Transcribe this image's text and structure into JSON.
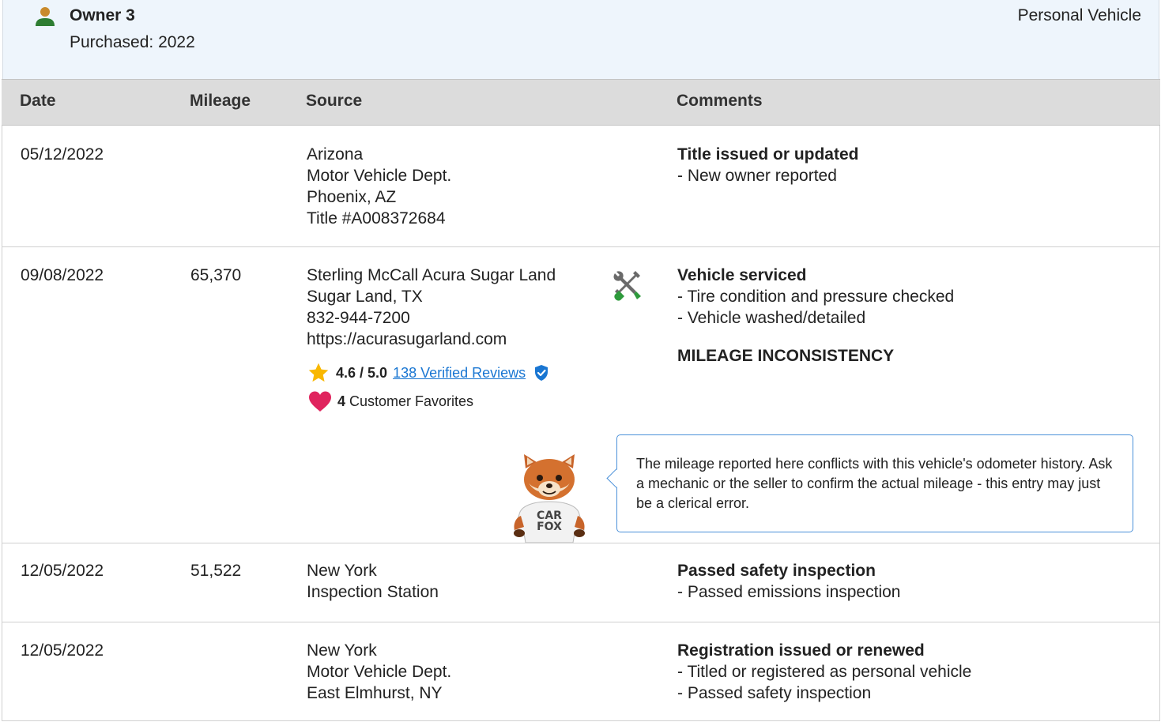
{
  "owner": {
    "name": "Owner 3",
    "purchased": "Purchased: 2022",
    "vehicle_type": "Personal Vehicle"
  },
  "table": {
    "headers": {
      "date": "Date",
      "mileage": "Mileage",
      "source": "Source",
      "comments": "Comments"
    },
    "rows": [
      {
        "date": "05/12/2022",
        "mileage": "",
        "source": [
          "Arizona",
          "Motor Vehicle Dept.",
          "Phoenix, AZ",
          "Title #A008372684"
        ],
        "comment_title": "Title issued or updated",
        "comment_items": [
          "- New owner reported"
        ]
      },
      {
        "date": "09/08/2022",
        "mileage": "65,370",
        "source": [
          "Sterling McCall Acura Sugar Land",
          "Sugar Land, TX",
          "832-944-7200",
          "https://acurasugarland.com"
        ],
        "service_icon": "wrench-screwdriver-icon",
        "rating": {
          "score": "4.6 / 5.0",
          "reviews_link": "138 Verified Reviews"
        },
        "favorites": {
          "count": "4",
          "label": "Customer Favorites"
        },
        "comment_title": "Vehicle serviced",
        "comment_items": [
          "- Tire condition and pressure checked",
          "- Vehicle washed/detailed"
        ],
        "alert_title": "MILEAGE INCONSISTENCY",
        "alert_message": "The mileage reported here conflicts with this vehicle's odometer history. Ask a mechanic or the seller to confirm the actual mileage - this entry may just be a clerical error.",
        "mascot_shirt": [
          "CAR",
          "FOX"
        ]
      },
      {
        "date": "12/05/2022",
        "mileage": "51,522",
        "source": [
          "New York",
          "Inspection Station"
        ],
        "comment_title": "Passed safety inspection",
        "comment_items": [
          "- Passed emissions inspection"
        ]
      },
      {
        "date": "12/05/2022",
        "mileage": "",
        "source": [
          "New York",
          "Motor Vehicle Dept.",
          "East Elmhurst, NY"
        ],
        "comment_title": "Registration issued or renewed",
        "comment_items": [
          "- Titled or registered as personal vehicle",
          "- Passed safety inspection"
        ]
      }
    ]
  },
  "colors": {
    "owner_icon": "#2e7d32",
    "header_bg": "#eef5fc",
    "table_head_bg": "#dcdcdc",
    "link": "#1976d2",
    "star": "#f9b800",
    "heart": "#e0245e",
    "bubble_border": "#4a90d9"
  }
}
